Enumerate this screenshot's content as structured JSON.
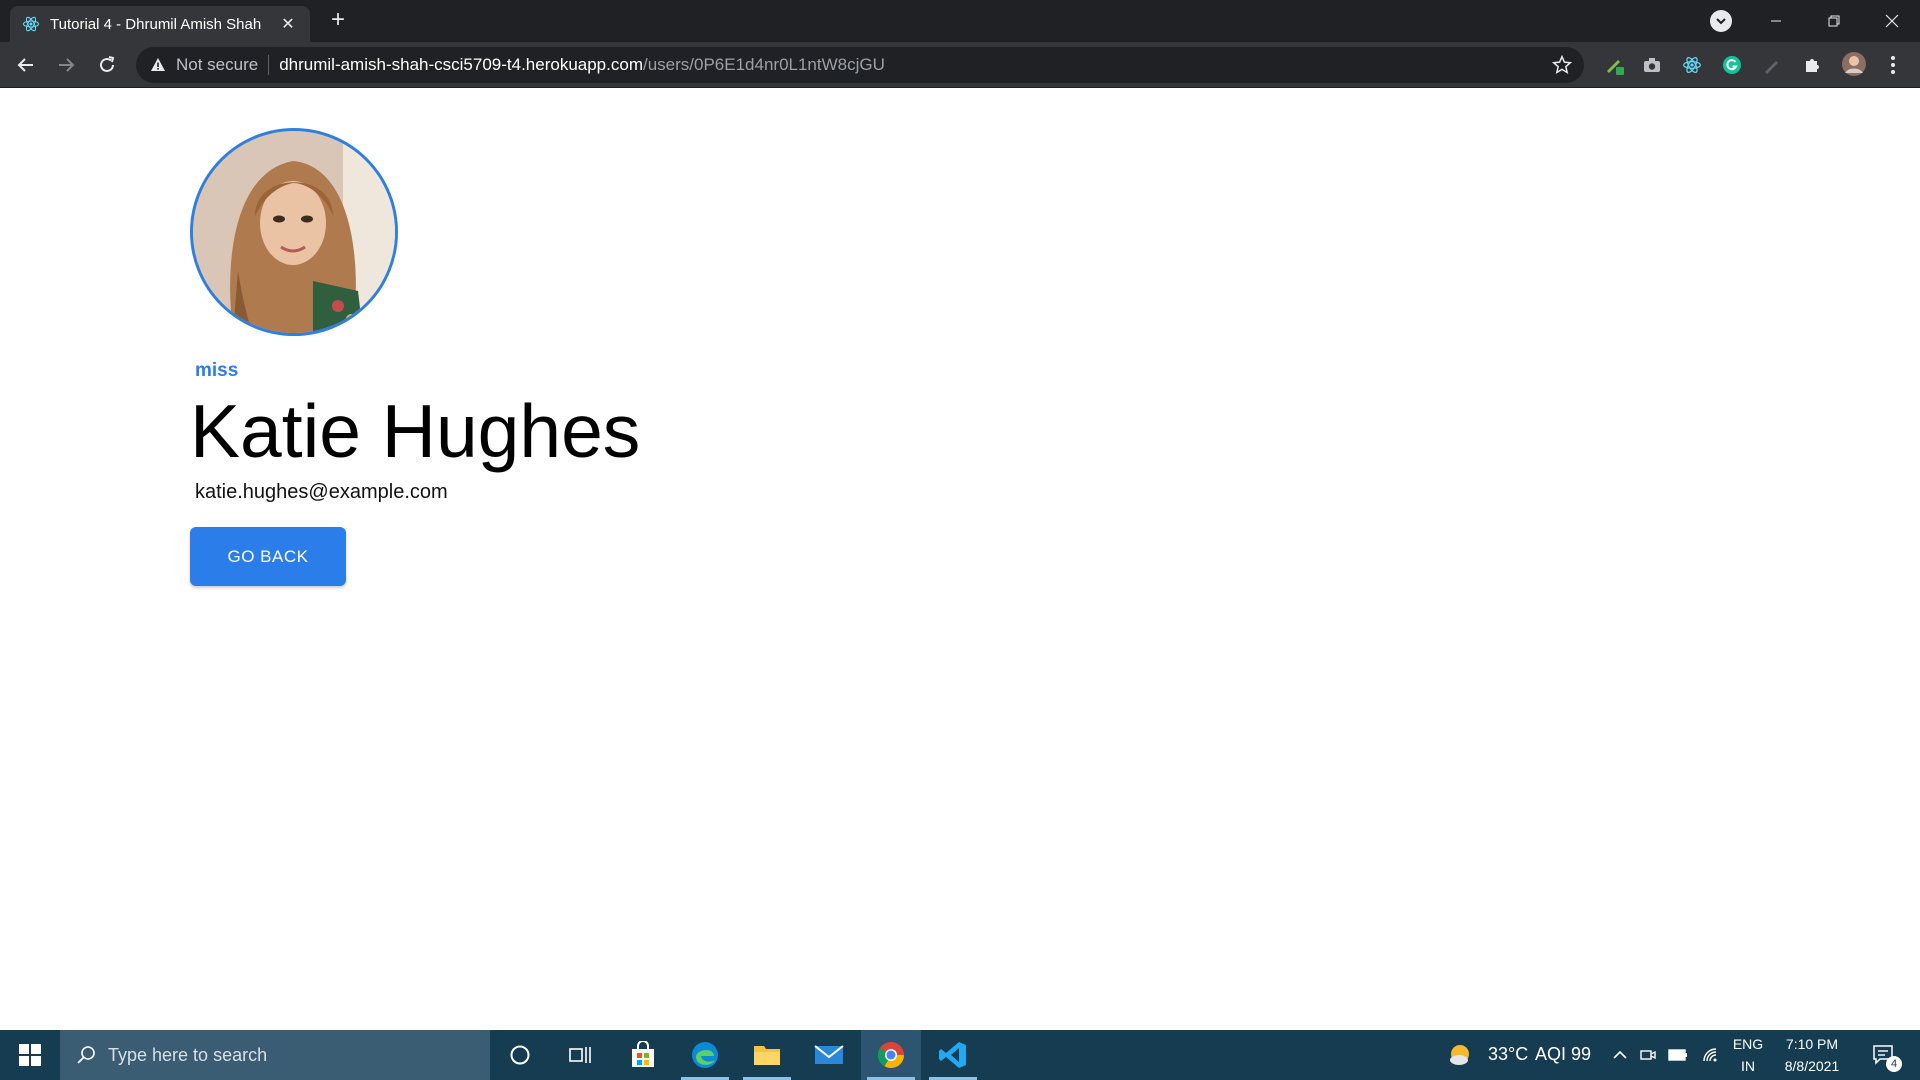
{
  "browser": {
    "tab": {
      "title": "Tutorial 4 - Dhrumil Amish Shah",
      "favicon": "react-icon"
    },
    "address_bar": {
      "security_label": "Not secure",
      "url_host": "dhrumil-amish-shah-csci5709-t4.herokuapp.com",
      "url_path": "/users/0P6E1d4nr0L1ntW8cjGU"
    }
  },
  "profile": {
    "title": "miss",
    "name": "Katie Hughes",
    "email": "katie.hughes@example.com",
    "back_button_label": "GO BACK"
  },
  "taskbar": {
    "search_placeholder": "Type here to search",
    "weather": {
      "temperature": "33°C",
      "aqi": "AQI 99"
    },
    "language": {
      "lang": "ENG",
      "region": "IN"
    },
    "clock": {
      "time": "7:10 PM",
      "date": "8/8/2021"
    },
    "notification_count": "4"
  },
  "colors": {
    "accent": "#2b7de9",
    "browser_dark": "#202124",
    "taskbar": "#163c52"
  }
}
